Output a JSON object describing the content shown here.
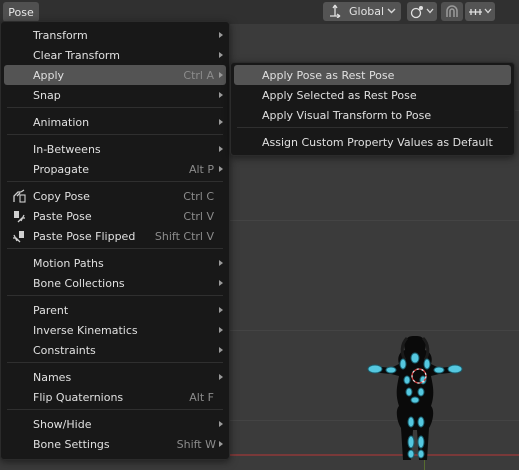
{
  "header": {
    "pose_menu": "Pose",
    "transform_orientation": "Global"
  },
  "pose_menu": {
    "items": [
      {
        "label": "Transform",
        "shortcut": "",
        "submenu": true
      },
      {
        "label": "Clear Transform",
        "shortcut": "",
        "submenu": true
      },
      {
        "label": "Apply",
        "shortcut": "Ctrl A",
        "submenu": true,
        "highlighted": true
      },
      {
        "label": "Snap",
        "shortcut": "",
        "submenu": true
      },
      {
        "label": "Animation",
        "shortcut": "",
        "submenu": true
      },
      {
        "label": "In-Betweens",
        "shortcut": "",
        "submenu": true
      },
      {
        "label": "Propagate",
        "shortcut": "Alt P",
        "submenu": true
      },
      {
        "label": "Copy Pose",
        "shortcut": "Ctrl C",
        "icon": "copy-pose-icon"
      },
      {
        "label": "Paste Pose",
        "shortcut": "Ctrl V",
        "icon": "paste-pose-icon"
      },
      {
        "label": "Paste Pose Flipped",
        "shortcut": "Shift Ctrl V",
        "icon": "paste-flipped-icon"
      },
      {
        "label": "Motion Paths",
        "shortcut": "",
        "submenu": true
      },
      {
        "label": "Bone Collections",
        "shortcut": "",
        "submenu": true
      },
      {
        "label": "Parent",
        "shortcut": "",
        "submenu": true
      },
      {
        "label": "Inverse Kinematics",
        "shortcut": "",
        "submenu": true
      },
      {
        "label": "Constraints",
        "shortcut": "",
        "submenu": true
      },
      {
        "label": "Names",
        "shortcut": "",
        "submenu": true
      },
      {
        "label": "Flip Quaternions",
        "shortcut": "Alt F"
      },
      {
        "label": "Show/Hide",
        "shortcut": "",
        "submenu": true
      },
      {
        "label": "Bone Settings",
        "shortcut": "Shift W",
        "submenu": true
      }
    ]
  },
  "apply_submenu": {
    "items": [
      {
        "label": "Apply Pose as Rest Pose",
        "highlighted": true
      },
      {
        "label": "Apply Selected as Rest Pose"
      },
      {
        "label": "Apply Visual Transform to Pose"
      },
      {
        "label": "Assign Custom Property Values as Default"
      }
    ]
  },
  "colors": {
    "menu_bg": "#181818",
    "highlight": "#545454",
    "bone_accent": "#55c8e0"
  }
}
